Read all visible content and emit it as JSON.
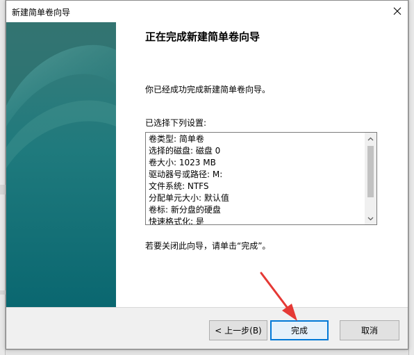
{
  "dialog": {
    "title": "新建简单卷向导",
    "heading": "正在完成新建简单卷向导",
    "intro": "你已经成功完成新建简单卷向导。",
    "settings_label": "已选择下列设置:",
    "settings": [
      "卷类型: 简单卷",
      "选择的磁盘: 磁盘 0",
      "卷大小: 1023 MB",
      "驱动器号或路径: M:",
      "文件系统: NTFS",
      "分配单元大小: 默认值",
      "卷标: 新分盘的硬盘",
      "快速格式化: 是"
    ],
    "closing": "若要关闭此向导，请单击“完成”。"
  },
  "buttons": {
    "back": "< 上一步(B)",
    "finish": "完成",
    "cancel": "取消"
  },
  "colors": {
    "accent": "#0078d7",
    "side_panel_top": "#2f8a88",
    "side_panel_bottom": "#0d6a73",
    "annotation_arrow": "#e53935"
  }
}
